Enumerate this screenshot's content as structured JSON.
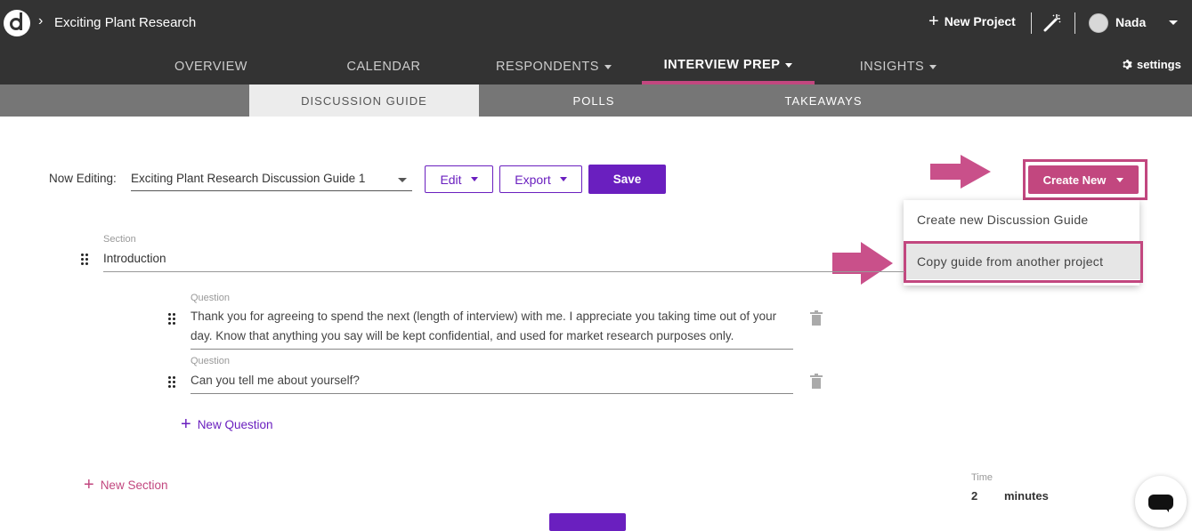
{
  "header": {
    "project_title": "Exciting Plant Research",
    "new_project_label": "New Project",
    "user_name": "Nada"
  },
  "nav": {
    "tabs": [
      {
        "label": "OVERVIEW",
        "active": false
      },
      {
        "label": "CALENDAR",
        "active": false
      },
      {
        "label": "RESPONDENTS",
        "active": false
      },
      {
        "label": "INTERVIEW PREP",
        "active": true
      },
      {
        "label": "INSIGHTS",
        "active": false
      }
    ],
    "settings_label": "settings"
  },
  "subnav": {
    "tabs": [
      {
        "label": "DISCUSSION GUIDE",
        "active": true
      },
      {
        "label": "POLLS",
        "active": false
      },
      {
        "label": "TAKEAWAYS",
        "active": false
      }
    ]
  },
  "toolbar": {
    "now_editing_label": "Now Editing:",
    "selected_guide": "Exciting Plant Research Discussion Guide 1",
    "edit_label": "Edit",
    "export_label": "Export",
    "save_label": "Save",
    "create_new_label": "Create New"
  },
  "create_menu": {
    "items": [
      {
        "label": "Create new Discussion Guide"
      },
      {
        "label": "Copy guide from another project"
      }
    ]
  },
  "guide": {
    "section_label": "Section",
    "section_value": "Introduction",
    "question_label": "Question",
    "questions": [
      {
        "value": "Thank you for agreeing to spend the next (length of interview) with me. I appreciate you taking time out of your day. Know that anything you say will be kept confidential, and used for market research purposes only."
      },
      {
        "value": "Can you tell me about yourself?"
      }
    ],
    "new_question_label": "New Question",
    "new_section_label": "New Section"
  },
  "time": {
    "label": "Time",
    "value": "2",
    "unit": "minutes"
  },
  "colors": {
    "topbar": "#333333",
    "accent_pink": "#c2477f",
    "primary_purple": "#6a1fbf",
    "subnav": "#767676"
  }
}
